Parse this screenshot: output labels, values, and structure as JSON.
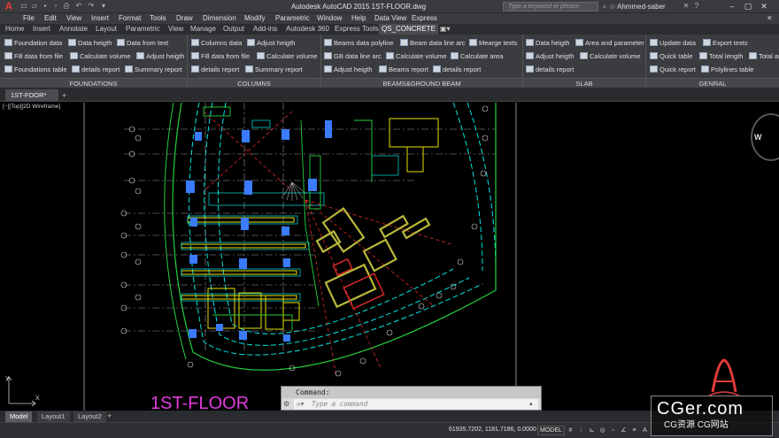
{
  "title_bar": {
    "app_title": "Autodesk AutoCAD 2015    1ST-FLOOR.dwg",
    "search_placeholder": "Type a keyword or phrase",
    "user": "Ahmmed-saber"
  },
  "menu": [
    "File",
    "Edit",
    "View",
    "Insert",
    "Format",
    "Tools",
    "Draw",
    "Dimension",
    "Modify",
    "Parametric",
    "Window",
    "Help",
    "Data View",
    "Express"
  ],
  "ribbon_tabs": [
    "Home",
    "Insert",
    "Annotate",
    "Layout",
    "Parametric",
    "View",
    "Manage",
    "Output",
    "Add-ins",
    "Autodesk 360",
    "Express Tools",
    "QS_CONCRETE"
  ],
  "active_ribbon_tab": "QS_CONCRETE",
  "ribbon": {
    "foundations": {
      "label": "FOUNDATIONS",
      "buttons": [
        "Foundation data",
        "Data heigth",
        "Data from text",
        "Fill data from file",
        "Calculate volume",
        "Adjust heigth",
        "Foundations table",
        "details report",
        "Summary report"
      ]
    },
    "columns": {
      "label": "COLUMNS",
      "buttons": [
        "Columns data",
        "Adjust heigth",
        "Fill data from file",
        "Calculate volume",
        "details report",
        "Summary report"
      ]
    },
    "beams": {
      "label": "BEAMS&GROUND BEAM",
      "buttons": [
        "Beams data polyline",
        "Beam data line arc",
        "Mearge texts",
        "GB data line arc",
        "Calculate volume",
        "Calculate area",
        "Adjust heigth",
        "Beams report",
        "details report"
      ]
    },
    "slab": {
      "label": "SLAB",
      "buttons": [
        "Data heigth",
        "Area and parameter",
        "Adjust heigth",
        "Calculate volume",
        "details report"
      ]
    },
    "general": {
      "label": "GENRAL",
      "buttons": [
        "Update data",
        "Export texts",
        "Quick table",
        "Total length",
        "Total ar",
        "Quick report",
        "Polylines table"
      ]
    }
  },
  "doc_tab": "1ST-FOOR*",
  "viewport_label": "[−][Top][2D Wireframe]",
  "compass_letter": "W",
  "drawing_label": "1ST-FLOOR",
  "command": {
    "header": "Command:",
    "placeholder": "Type a command"
  },
  "layout_tabs": [
    "Model",
    "Layout1",
    "Layout2"
  ],
  "status": {
    "coords": "61935.7202, 1181.7186, 0.0000",
    "mode": "MODEL"
  },
  "watermark": {
    "main": "CGer.com",
    "sub": "CG资源 CG网站"
  },
  "colors": {
    "cyan": "#00e5e5",
    "yellow": "#e6e000",
    "green": "#23d23d",
    "red": "#e02a2a",
    "blue": "#3a7bff",
    "magenta": "#e23cde",
    "olive": "#b8b83a"
  }
}
